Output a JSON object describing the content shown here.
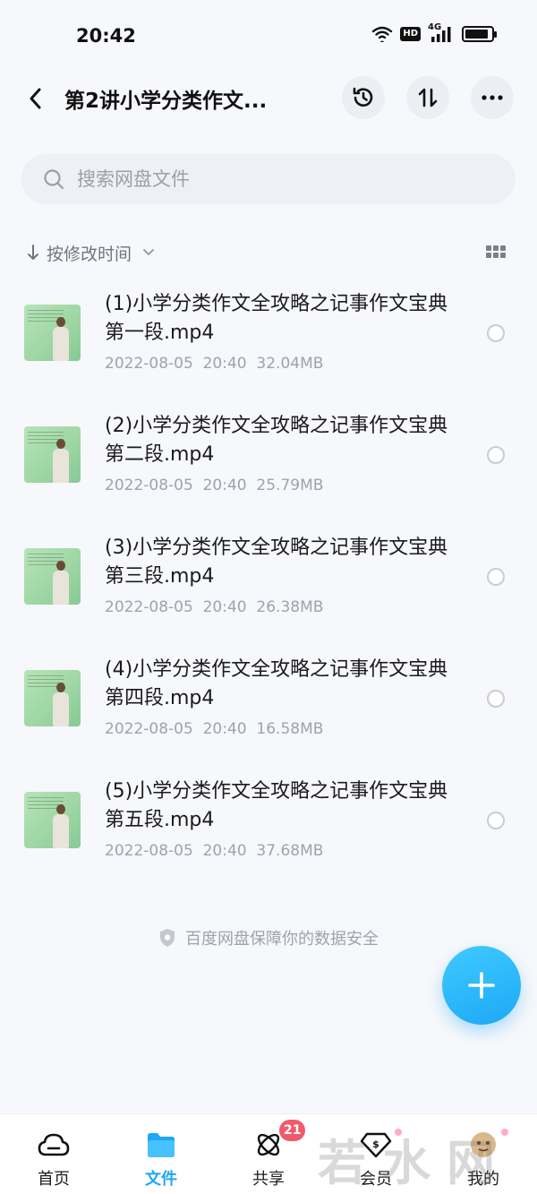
{
  "status_bar": {
    "time": "20:42",
    "network": "4G",
    "hd": "HD",
    "battery_level": 0.9
  },
  "header": {
    "title": "第2讲小学分类作文...",
    "icons": [
      "back-arrow-icon",
      "history-icon",
      "sort-icon",
      "more-icon"
    ]
  },
  "search": {
    "placeholder": "搜索网盘文件"
  },
  "sort": {
    "label": "按修改时间"
  },
  "files": [
    {
      "name": "(1)小学分类作文全攻略之记事作文宝典第一段.mp4",
      "date": "2022-08-05",
      "time": "20:40",
      "size": "32.04MB"
    },
    {
      "name": "(2)小学分类作文全攻略之记事作文宝典第二段.mp4",
      "date": "2022-08-05",
      "time": "20:40",
      "size": "25.79MB"
    },
    {
      "name": "(3)小学分类作文全攻略之记事作文宝典第三段.mp4",
      "date": "2022-08-05",
      "time": "20:40",
      "size": "26.38MB"
    },
    {
      "name": "(4)小学分类作文全攻略之记事作文宝典第四段.mp4",
      "date": "2022-08-05",
      "time": "20:40",
      "size": "16.58MB"
    },
    {
      "name": "(5)小学分类作文全攻略之记事作文宝典第五段.mp4",
      "date": "2022-08-05",
      "time": "20:40",
      "size": "37.68MB"
    }
  ],
  "safe_note": "百度网盘保障你的数据安全",
  "tabs": [
    {
      "label": "首页",
      "icon": "cloud-icon",
      "active": false
    },
    {
      "label": "文件",
      "icon": "folder-icon",
      "active": true
    },
    {
      "label": "共享",
      "icon": "atom-icon",
      "active": false,
      "badge": "21"
    },
    {
      "label": "会员",
      "icon": "diamond-icon",
      "active": false
    },
    {
      "label": "我的",
      "icon": "profile-icon",
      "active": false
    }
  ],
  "watermark": "若水网",
  "colors": {
    "accent": "#1da8f5",
    "badge": "#f25a6b",
    "background": "#f7f8fb"
  }
}
